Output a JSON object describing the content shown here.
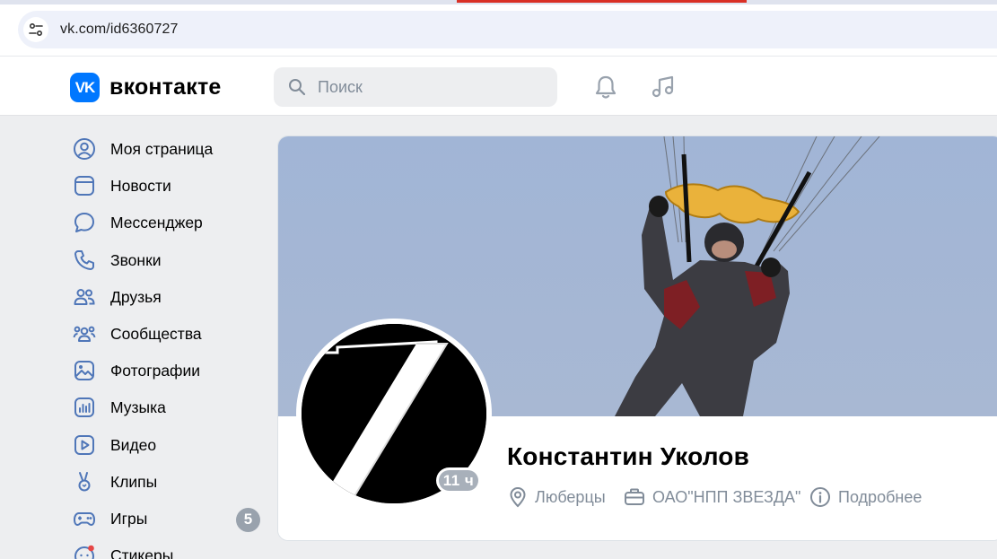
{
  "browser": {
    "url": "vk.com/id6360727"
  },
  "header": {
    "logo_mark": "VK",
    "logo_text": "вконтакте",
    "search_placeholder": "Поиск"
  },
  "sidebar": {
    "items": [
      {
        "label": "Моя страница",
        "icon": "user-circle-icon"
      },
      {
        "label": "Новости",
        "icon": "news-icon"
      },
      {
        "label": "Мессенджер",
        "icon": "message-icon"
      },
      {
        "label": "Звонки",
        "icon": "phone-icon"
      },
      {
        "label": "Друзья",
        "icon": "friends-icon"
      },
      {
        "label": "Сообщества",
        "icon": "communities-icon"
      },
      {
        "label": "Фотографии",
        "icon": "photo-icon"
      },
      {
        "label": "Музыка",
        "icon": "music-icon"
      },
      {
        "label": "Видео",
        "icon": "video-icon"
      },
      {
        "label": "Клипы",
        "icon": "clips-icon"
      },
      {
        "label": "Игры",
        "icon": "gamepad-icon",
        "badge": "5"
      },
      {
        "label": "Стикеры",
        "icon": "sticker-icon"
      }
    ]
  },
  "profile": {
    "name": "Константин Уколов",
    "last_seen": "11 ч",
    "city": "Люберцы",
    "work": "ОАО\"НПП ЗВЕЗДА\"",
    "more": "Подробнее"
  },
  "colors": {
    "brand": "#0077ff",
    "page_bg": "#edeef0",
    "icon": "#4f76b8",
    "secondary_text": "#818c99",
    "cover_sky": "#a3b6d6"
  }
}
